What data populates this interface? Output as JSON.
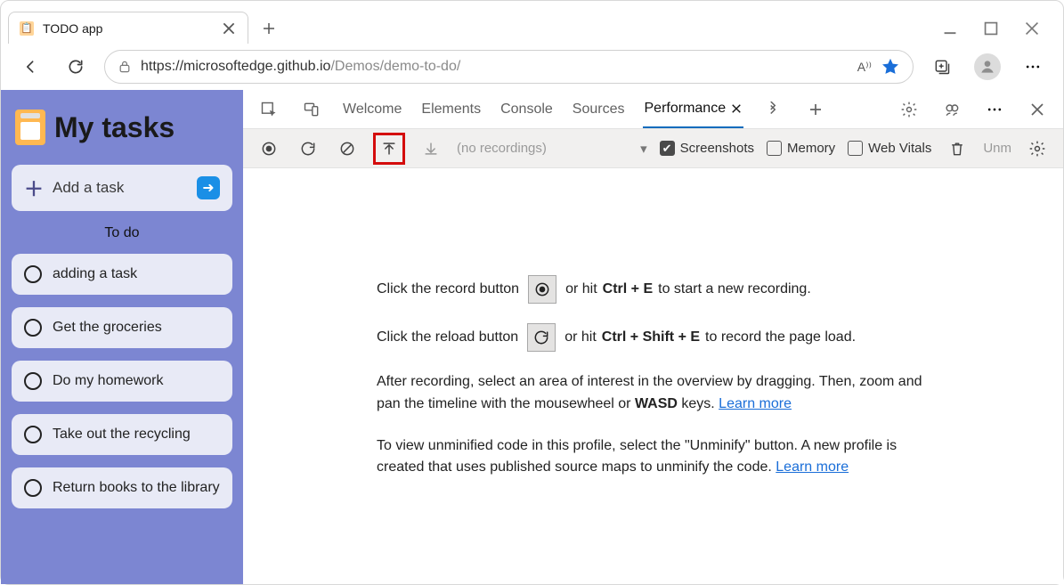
{
  "browser": {
    "tab_title": "TODO app",
    "url_base": "https://microsoftedge.github.io",
    "url_rest": "/Demos/demo-to-do/"
  },
  "app": {
    "title": "My tasks",
    "add_task_label": "Add a task",
    "section_label": "To do",
    "tasks": [
      "adding a task",
      "Get the groceries",
      "Do my homework",
      "Take out the recycling",
      "Return books to the library"
    ]
  },
  "devtools": {
    "tabs": {
      "welcome": "Welcome",
      "elements": "Elements",
      "console": "Console",
      "sources": "Sources",
      "performance": "Performance"
    },
    "toolbar": {
      "empty_text": "(no recordings)",
      "screenshots": "Screenshots",
      "memory": "Memory",
      "web_vitals": "Web Vitals",
      "unminify": "Unm"
    },
    "hints": {
      "record_1": "Click the record button",
      "record_2": "or hit",
      "record_hotkey": "Ctrl + E",
      "record_3": "to start a new recording.",
      "reload_1": "Click the reload button",
      "reload_2": "or hit",
      "reload_hotkey": "Ctrl + Shift + E",
      "reload_3": "to record the page load.",
      "para1_a": "After recording, select an area of interest in the overview by dragging. Then, zoom and pan the timeline with the mousewheel or ",
      "para1_b": "WASD",
      "para1_c": " keys. ",
      "para2_a": "To view unminified code in this profile, select the \"Unminify\" button. A new profile is created that uses published source maps to unminify the code. ",
      "learn_more": "Learn more"
    }
  }
}
